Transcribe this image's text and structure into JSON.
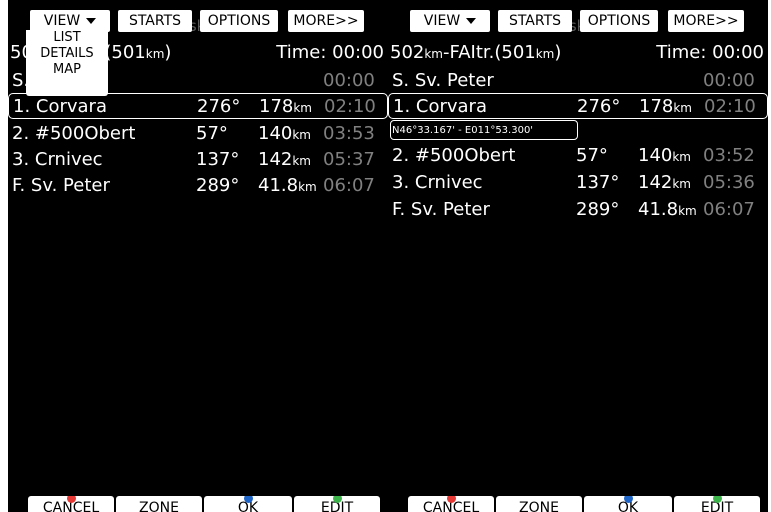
{
  "colors": {
    "cancel": "#e53935",
    "ok": "#1e63c6",
    "edit": "#3bb34a",
    "eta_gray": "#808080"
  },
  "left": {
    "topbar": {
      "view": "VIEW",
      "starts": "STARTS",
      "options": "OPTIONS",
      "more": "MORE>>",
      "ghost": "Task Edit"
    },
    "menu": {
      "items": [
        "LIST",
        "DETAILS",
        "MAP"
      ]
    },
    "header": {
      "task_prefix": "50",
      "task_tail": "r.(501",
      "task_unit": "km",
      "task_close": ")",
      "time": "Time: 00:00"
    },
    "rows": [
      {
        "name": "S.",
        "name_tail": "er",
        "bearing": "",
        "dist": "",
        "unit": "",
        "eta": "00:00"
      },
      {
        "name": "1. Corvara",
        "bearing": "276°",
        "dist": "178",
        "unit": "km",
        "eta": "02:10"
      },
      {
        "name": "2. #500Obert",
        "bearing": "57°",
        "dist": "140",
        "unit": "km",
        "eta": "03:53"
      },
      {
        "name": "3. Crnivec",
        "bearing": "137°",
        "dist": "142",
        "unit": "km",
        "eta": "05:37"
      },
      {
        "name": "F. Sv. Peter",
        "bearing": "289°",
        "dist": "41.8",
        "unit": "km",
        "eta": "06:07"
      }
    ],
    "bottombar": {
      "cancel": "CANCEL",
      "zone": "ZONE",
      "ok": "OK",
      "edit": "EDIT"
    }
  },
  "right": {
    "topbar": {
      "view": "VIEW",
      "starts": "STARTS",
      "options": "OPTIONS",
      "more": "MORE>>",
      "ghost": "Task Edit"
    },
    "header": {
      "task_a": "502",
      "task_unit": "km",
      "task_b": "-FAItr.(501",
      "task_unit2": "km",
      "task_close": ")",
      "time": "Time: 00:00"
    },
    "rows": [
      {
        "name": "S. Sv. Peter",
        "bearing": "",
        "dist": "",
        "unit": "",
        "eta": "00:00"
      },
      {
        "name": "1. Corvara",
        "bearing": "276°",
        "dist": "178",
        "unit": "km",
        "eta": "02:10"
      },
      {
        "name": "2. #500Obert",
        "bearing": "57°",
        "dist": "140",
        "unit": "km",
        "eta": "03:52"
      },
      {
        "name": "3. Crnivec",
        "bearing": "137°",
        "dist": "142",
        "unit": "km",
        "eta": "05:36"
      },
      {
        "name": "F. Sv. Peter",
        "bearing": "289°",
        "dist": "41.8",
        "unit": "km",
        "eta": "06:07"
      }
    ],
    "coords": "N46°33.167' - E011°53.300'",
    "bottombar": {
      "cancel": "CANCEL",
      "zone": "ZONE",
      "ok": "OK",
      "edit": "EDIT"
    }
  }
}
